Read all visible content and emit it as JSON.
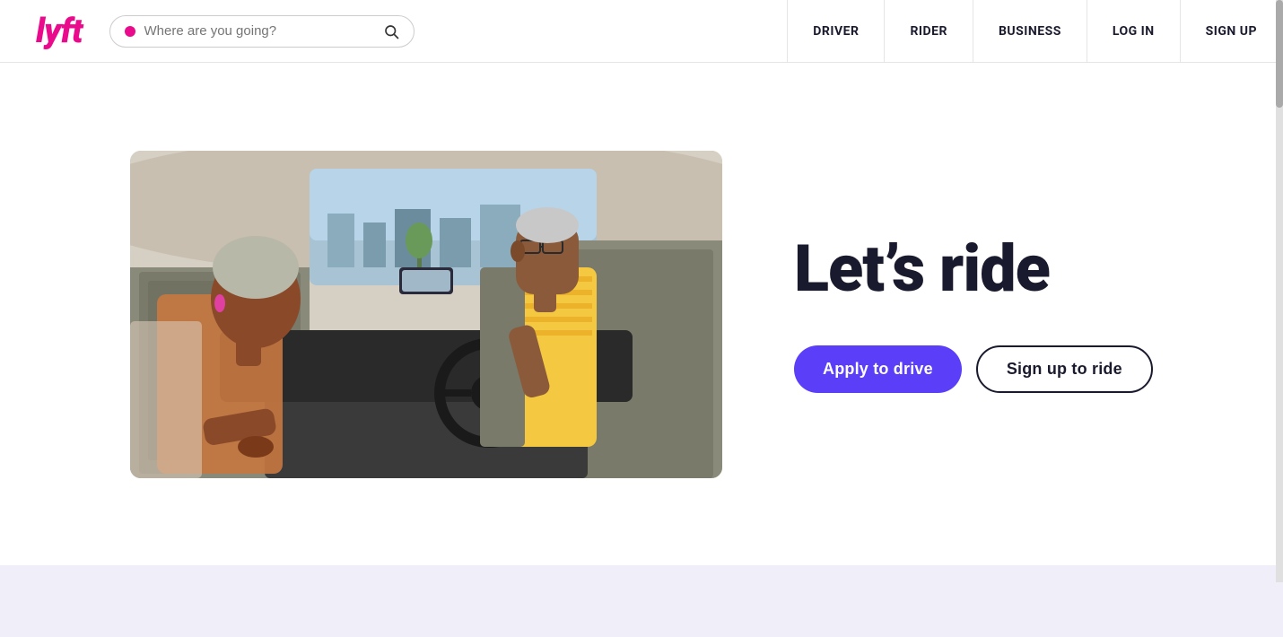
{
  "header": {
    "logo": "lyft",
    "search": {
      "placeholder": "Where are you going?"
    },
    "nav_items": [
      {
        "id": "driver",
        "label": "DRIVER"
      },
      {
        "id": "rider",
        "label": "RIDER"
      },
      {
        "id": "business",
        "label": "BUSINESS"
      },
      {
        "id": "login",
        "label": "LOG IN"
      },
      {
        "id": "signup",
        "label": "SIGN UP"
      }
    ]
  },
  "hero": {
    "heading": "Let’s ride",
    "apply_button": "Apply to drive",
    "signup_button": "Sign up to ride"
  },
  "colors": {
    "lyft_pink": "#ea0b8c",
    "lyft_purple": "#5b3ff8",
    "nav_text": "#1a1a2e",
    "footer_bg": "#f0eef8"
  }
}
